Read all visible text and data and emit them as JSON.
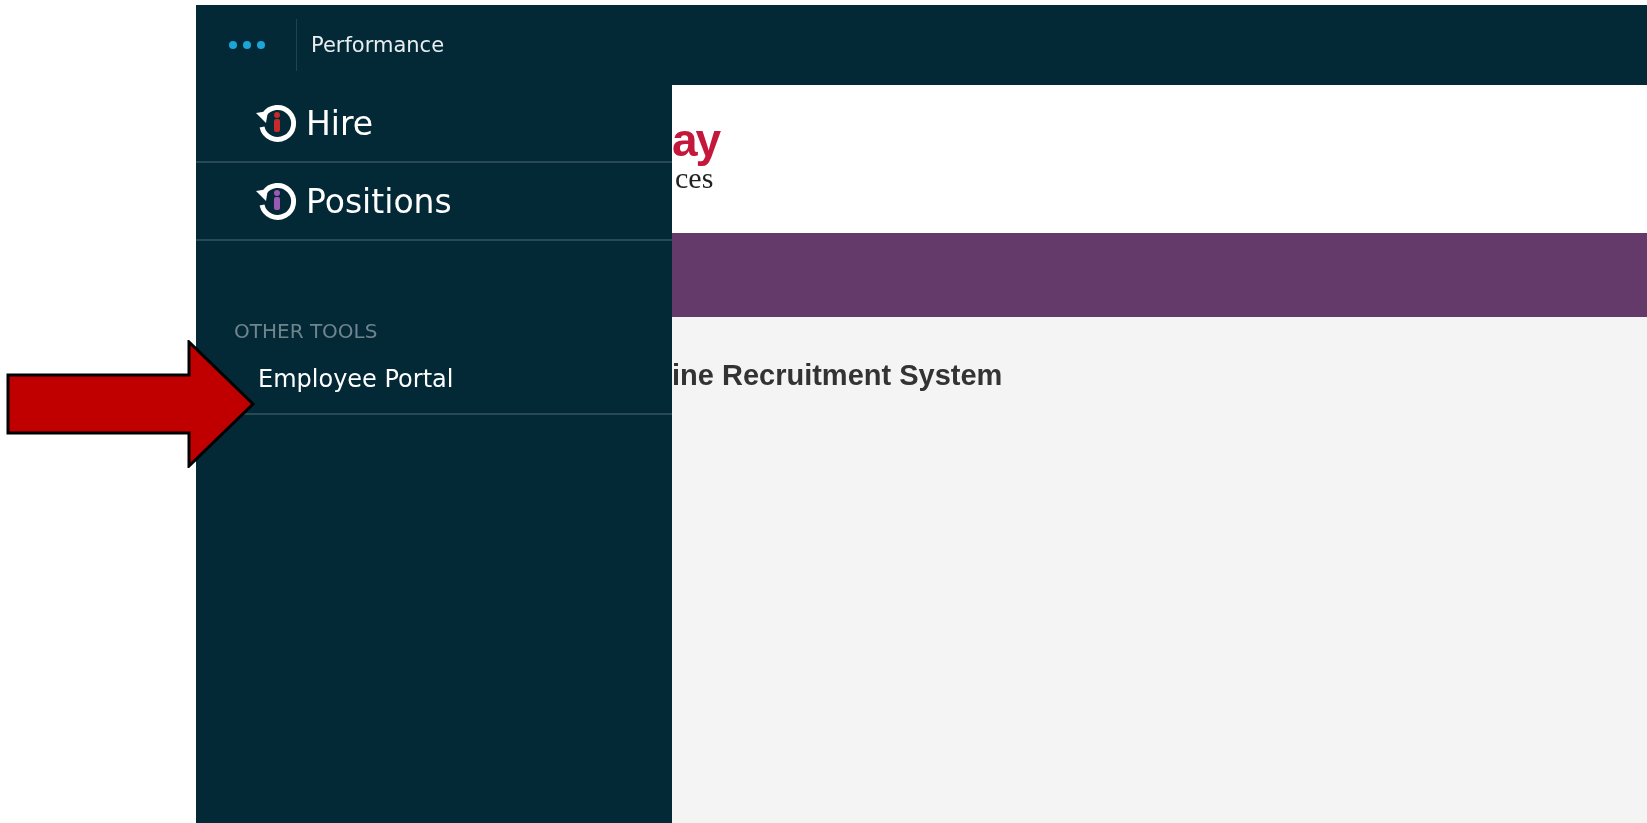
{
  "top_bar": {
    "app_title": "Performance"
  },
  "sidebar": {
    "items": [
      {
        "label": "Hire",
        "color": "#c62a2a"
      },
      {
        "label": "Positions",
        "color": "#9b59b6"
      }
    ],
    "section_title": "OTHER TOOLS",
    "links": [
      "Employee Portal"
    ]
  },
  "content": {
    "logo_top": "ay",
    "logo_bottom": "ces",
    "heading": "ine Recruitment System"
  },
  "annotation": {
    "kind": "arrow"
  }
}
